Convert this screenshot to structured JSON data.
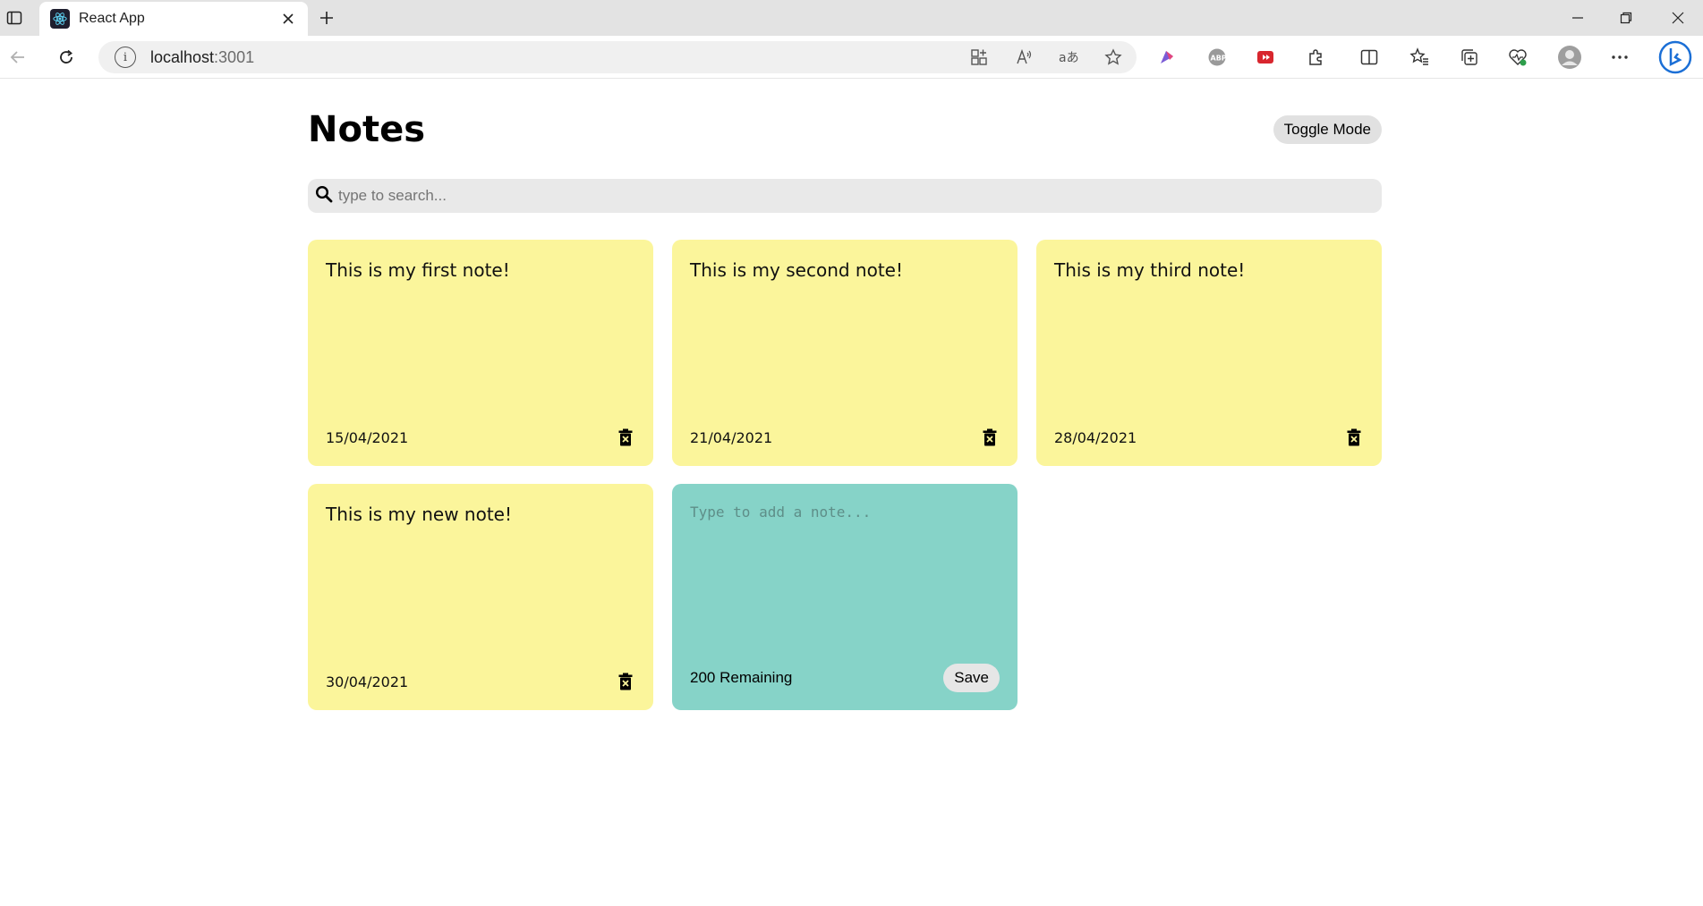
{
  "browser": {
    "tab_title": "React App",
    "url_host": "localhost",
    "url_port": ":3001"
  },
  "app": {
    "title": "Notes",
    "toggle_label": "Toggle Mode",
    "search_placeholder": "type to search...",
    "notes": [
      {
        "text": "This is my first note!",
        "date": "15/04/2021"
      },
      {
        "text": "This is my second note!",
        "date": "21/04/2021"
      },
      {
        "text": "This is my third note!",
        "date": "28/04/2021"
      },
      {
        "text": "This is my new note!",
        "date": "30/04/2021"
      }
    ],
    "new_note": {
      "placeholder": "Type to add a note...",
      "remaining": "200 Remaining",
      "save_label": "Save"
    }
  },
  "colors": {
    "note_bg": "#fbf59b",
    "new_note_bg": "#86d3c8",
    "search_bg": "#e9e9e9"
  }
}
